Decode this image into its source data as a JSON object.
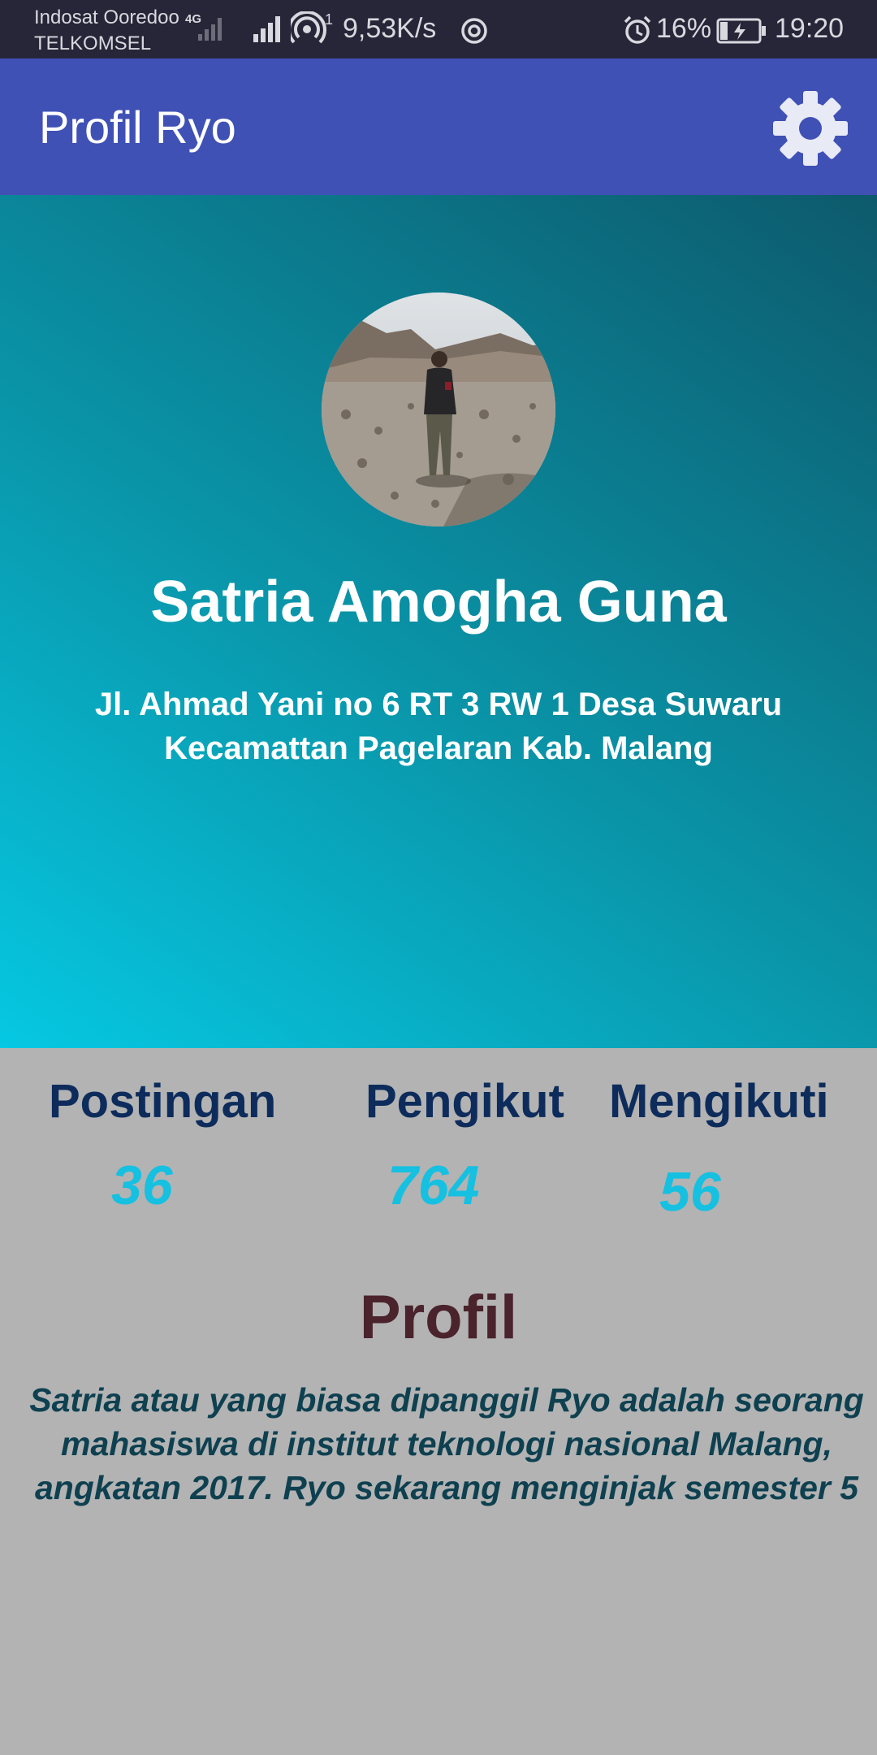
{
  "status_bar": {
    "carrier_1": "Indosat Ooredoo",
    "carrier_2": "TELKOMSEL",
    "network_type": "4G",
    "hotspot_count": "1",
    "net_speed": "9,53K/s",
    "battery_percent": "16%",
    "time": "19:20"
  },
  "app_bar": {
    "title": "Profil Ryo",
    "settings_icon": "gear-icon"
  },
  "profile": {
    "name": "Satria Amogha Guna",
    "address_line1": "Jl. Ahmad Yani no 6 RT 3 RW 1 Desa Suwaru",
    "address_line2": "Kecamattan Pagelaran Kab. Malang"
  },
  "stats": {
    "posts_label": "Postingan",
    "posts_value": "36",
    "followers_label": "Pengikut",
    "followers_value": "764",
    "following_label": "Mengikuti",
    "following_value": "56"
  },
  "about": {
    "heading": "Profil",
    "bio_line1": "Satria atau yang biasa dipanggil Ryo adalah seorang",
    "bio_line2": "mahasiswa di institut teknologi nasional Malang,",
    "bio_line3": "angkatan 2017. Ryo sekarang menginjak semester 5"
  },
  "colors": {
    "app_bar": "#3f51b5",
    "status_bar": "#262638",
    "stat_label": "#0d2c5c",
    "stat_value": "#16c0e0",
    "heading": "#4a232c",
    "bio": "#0e4050",
    "background": "#b3b3b3"
  }
}
